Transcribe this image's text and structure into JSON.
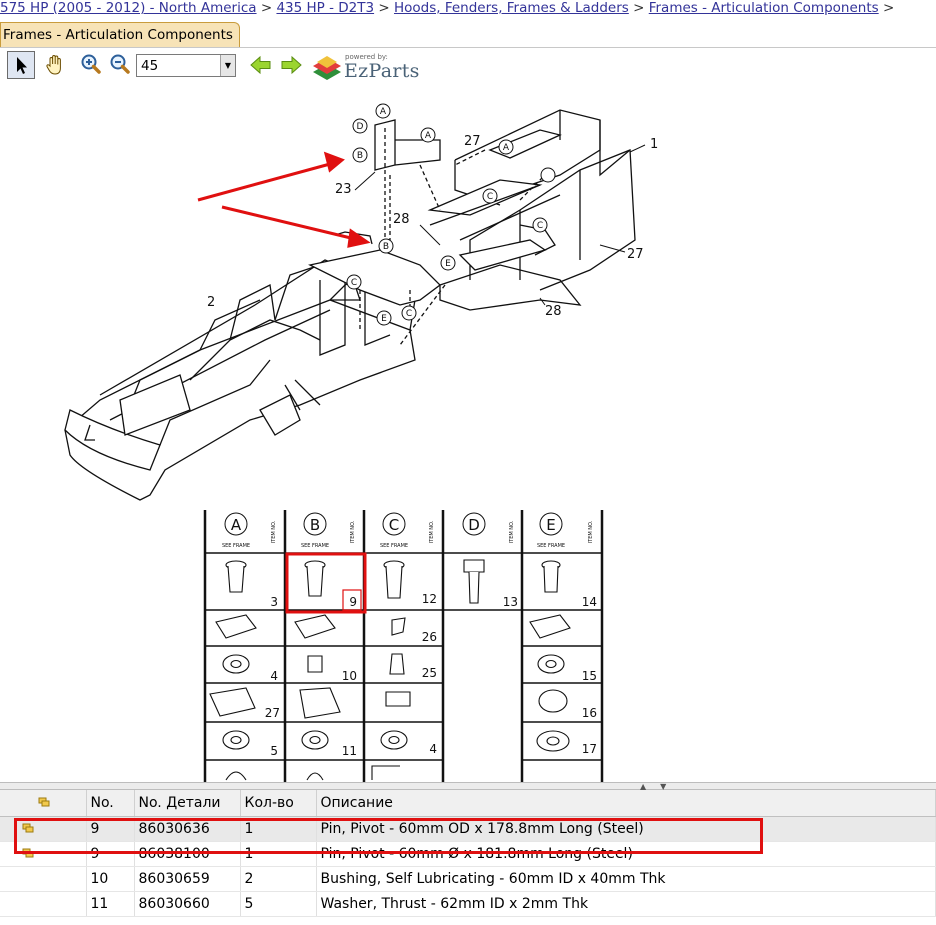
{
  "breadcrumb": {
    "items": [
      "575 HP (2005 - 2012) - North America",
      "435 HP - D2T3",
      "Hoods, Fenders, Frames & Ladders",
      "Frames - Articulation Components"
    ],
    "separator": ">"
  },
  "tab": {
    "label": "Frames - Articulation Components"
  },
  "toolbar": {
    "zoom_value": "45",
    "logo_powered": "powered by:",
    "logo_name": "EzParts",
    "tools": [
      "select-pointer-icon",
      "pan-hand-icon",
      "zoom-in-icon",
      "zoom-out-icon",
      "prev-arrow-icon",
      "next-arrow-icon"
    ]
  },
  "diagram": {
    "callouts": [
      "1",
      "2",
      "23",
      "27",
      "27",
      "28",
      "28"
    ],
    "letter_markers": [
      "A",
      "A",
      "A",
      "B",
      "B",
      "C",
      "C",
      "C",
      "C",
      "D",
      "E",
      "E"
    ],
    "legend_headers": [
      {
        "letter": "A",
        "sub": "SEE FRAME",
        "side": "ITEM NO."
      },
      {
        "letter": "B",
        "sub": "SEE FRAME",
        "side": "ITEM NO."
      },
      {
        "letter": "C",
        "sub": "SEE FRAME",
        "side": "ITEM NO."
      },
      {
        "letter": "D",
        "sub": "SEE FRAME",
        "side": "ITEM NO."
      },
      {
        "letter": "E",
        "sub": "SEE FRAME",
        "side": "ITEM NO."
      }
    ],
    "legend_rows": [
      [
        "3",
        "9",
        "12",
        "13",
        "14"
      ],
      [
        "",
        "",
        "26",
        "",
        ""
      ],
      [
        "4",
        "10",
        "25",
        "",
        "15"
      ],
      [
        "27",
        "",
        "",
        "",
        "16"
      ],
      [
        "5",
        "11",
        "4",
        "",
        "17"
      ]
    ],
    "highlight_color": "#e01010"
  },
  "grid": {
    "headers": [
      "",
      "No.",
      "No. Детали",
      "Кол-во",
      "Описание"
    ],
    "rows": [
      {
        "no": "9",
        "part": "86030636",
        "qty": "1",
        "desc": "Pin, Pivot - 60mm OD x 178.8mm Long (Steel)",
        "icon": true,
        "selected": true
      },
      {
        "no": "9",
        "part": "86038100",
        "qty": "1",
        "desc": "Pin, Pivot - 60mm Ø x 181.8mm Long (Steel)",
        "icon": true,
        "selected": false
      },
      {
        "no": "10",
        "part": "86030659",
        "qty": "2",
        "desc": "Bushing, Self Lubricating - 60mm ID x 40mm Thk",
        "icon": false,
        "selected": false
      },
      {
        "no": "11",
        "part": "86030660",
        "qty": "5",
        "desc": "Washer, Thrust - 62mm ID x 2mm Thk",
        "icon": false,
        "selected": false
      }
    ]
  },
  "colors": {
    "link": "#333399",
    "tab_bg": "#f7e3b7",
    "highlight": "#e01010"
  }
}
